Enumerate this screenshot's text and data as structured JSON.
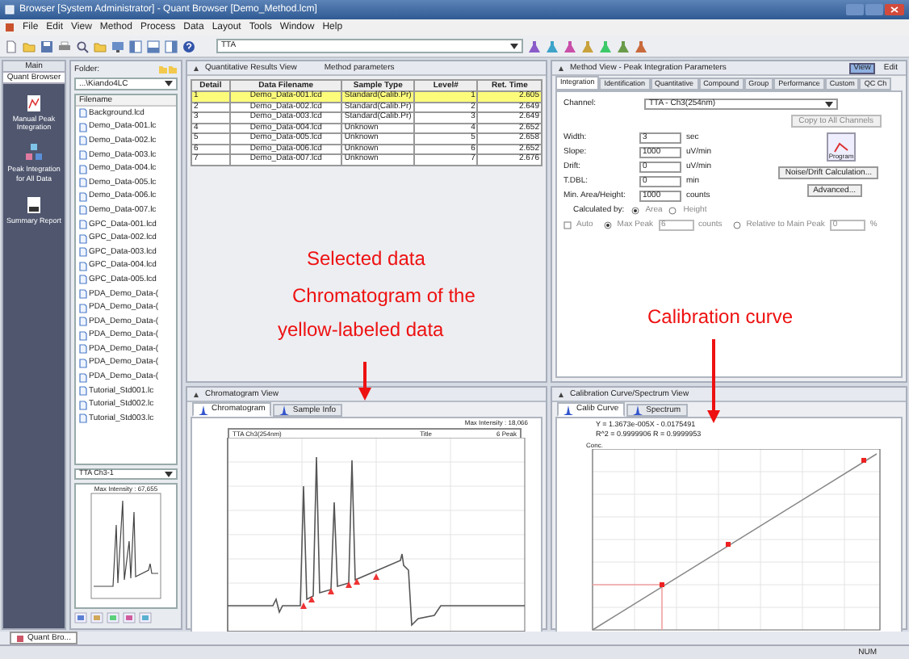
{
  "window": {
    "title": "Browser [System Administrator] - Quant Browser [Demo_Method.lcm]"
  },
  "menu": [
    "File",
    "Edit",
    "View",
    "Method",
    "Process",
    "Data",
    "Layout",
    "Tools",
    "Window",
    "Help"
  ],
  "toolbar": {
    "channel_select": "TTA"
  },
  "sidebar": {
    "title": "Main",
    "section": "Quant Browser",
    "items": [
      {
        "label": "Manual Peak Integration"
      },
      {
        "label": "Peak Integration for All Data"
      },
      {
        "label": "Summary Report"
      }
    ]
  },
  "folder_panel": {
    "label": "Folder:",
    "folder": "...\\Kiando4LC",
    "column": "Filename",
    "files": [
      "Background.lcd",
      "Demo_Data-001.lc",
      "Demo_Data-002.lc",
      "Demo_Data-003.lc",
      "Demo_Data-004.lc",
      "Demo_Data-005.lc",
      "Demo_Data-006.lc",
      "Demo_Data-007.lc",
      "GPC_Data-001.lcd",
      "GPC_Data-002.lcd",
      "GPC_Data-003.lcd",
      "GPC_Data-004.lcd",
      "GPC_Data-005.lcd",
      "PDA_Demo_Data-(",
      "PDA_Demo_Data-(",
      "PDA_Demo_Data-(",
      "PDA_Demo_Data-(",
      "PDA_Demo_Data-(",
      "PDA_Demo_Data-(",
      "PDA_Demo_Data-(",
      "Tutorial_Std001.lc",
      "Tutorial_Std002.lc",
      "Tutorial_Std003.lc"
    ],
    "preview_channel": "TTA Ch3-1",
    "preview_intensity": "Max Intensity : 67,655"
  },
  "results_view": {
    "title": "Quantitative Results View",
    "method_label": "Method parameters",
    "columns": [
      "Detail",
      "Data Filename",
      "Sample Type",
      "Level#",
      "Ret. Time"
    ],
    "rows": [
      {
        "selected": true,
        "cells": [
          "1",
          "Demo_Data-001.lcd",
          "Standard(Calib.Pr)",
          "1",
          "2.605"
        ]
      },
      {
        "selected": false,
        "cells": [
          "2",
          "Demo_Data-002.lcd",
          "Standard(Calib.Pr)",
          "2",
          "2.649"
        ]
      },
      {
        "selected": false,
        "cells": [
          "3",
          "Demo_Data-003.lcd",
          "Standard(Calib.Pr)",
          "3",
          "2.649"
        ]
      },
      {
        "selected": false,
        "cells": [
          "4",
          "Demo_Data-004.lcd",
          "Unknown",
          "4",
          "2.652"
        ]
      },
      {
        "selected": false,
        "cells": [
          "5",
          "Demo_Data-005.lcd",
          "Unknown",
          "5",
          "2.658"
        ]
      },
      {
        "selected": false,
        "cells": [
          "6",
          "Demo_Data-006.lcd",
          "Unknown",
          "6",
          "2.652"
        ]
      },
      {
        "selected": false,
        "cells": [
          "7",
          "Demo_Data-007.lcd",
          "Unknown",
          "7",
          "2.676"
        ]
      }
    ]
  },
  "method_view": {
    "title": "Method View - Peak Integration Parameters",
    "view_button": "View",
    "edit_button": "Edit",
    "tabs": [
      {
        "label": "Integration",
        "selected": true
      },
      {
        "label": "Identification",
        "selected": false
      },
      {
        "label": "Quantitative",
        "selected": false
      },
      {
        "label": "Compound",
        "selected": false
      },
      {
        "label": "Group",
        "selected": false
      },
      {
        "label": "Performance",
        "selected": false
      },
      {
        "label": "Custom",
        "selected": false
      },
      {
        "label": "QC Ch",
        "selected": false
      }
    ],
    "channel_label": "Channel:",
    "channel_value": "TTA - Ch3(254nm)",
    "copy_button": "Copy to All Channels",
    "params": [
      {
        "label": "Width:",
        "value": "3",
        "unit": "sec"
      },
      {
        "label": "Slope:",
        "value": "1000",
        "unit": "uV/min"
      },
      {
        "label": "Drift:",
        "value": "0",
        "unit": "uV/min"
      },
      {
        "label": "T.DBL:",
        "value": "0",
        "unit": "min"
      },
      {
        "label": "Min. Area/Height:",
        "value": "1000",
        "unit": "counts"
      }
    ],
    "program_button": "Program",
    "noise_button": "Noise/Drift Calculation...",
    "advanced_button": "Advanced...",
    "calculated_by": {
      "label": "Calculated by:",
      "options": [
        {
          "label": "Area",
          "selected": true
        },
        {
          "label": "Height",
          "selected": false
        }
      ]
    },
    "auto": {
      "label": "Auto",
      "checked": false,
      "disabled": true
    },
    "peak_options": [
      {
        "label": "Max Peak",
        "selected": true,
        "disabled": true,
        "value": "6",
        "unit": "counts"
      },
      {
        "label": "Relative to Main Peak",
        "selected": false,
        "disabled": true,
        "value": "0",
        "unit": "%"
      }
    ]
  },
  "chromatogram_view": {
    "title": "Chromatogram View",
    "tabs": [
      {
        "label": "Chromatogram",
        "selected": true
      },
      {
        "label": "Sample Info",
        "selected": false
      }
    ],
    "channel": "TTA Ch3(254nm)",
    "intensity": "Max Intensity : 18,066",
    "legend_1": "Title",
    "legend_2": "6 Peak"
  },
  "calibration_view": {
    "title": "Calibration Curve/Spectrum View",
    "tabs": [
      {
        "label": "Calib Curve",
        "selected": true
      },
      {
        "label": "Spectrum",
        "selected": false
      }
    ],
    "equation": "Y = 1.3673e-005X - 0.0175491",
    "r_squared": "R^2 = 0.9999906  R = 0.9999953",
    "ylabel": "Conc."
  },
  "annotations": [
    "Selected data",
    "Chromatogram of the",
    "yellow-labeled data",
    "Calibration curve"
  ],
  "bottom_tab": "Quant Bro...",
  "status_bar": "NUM"
}
